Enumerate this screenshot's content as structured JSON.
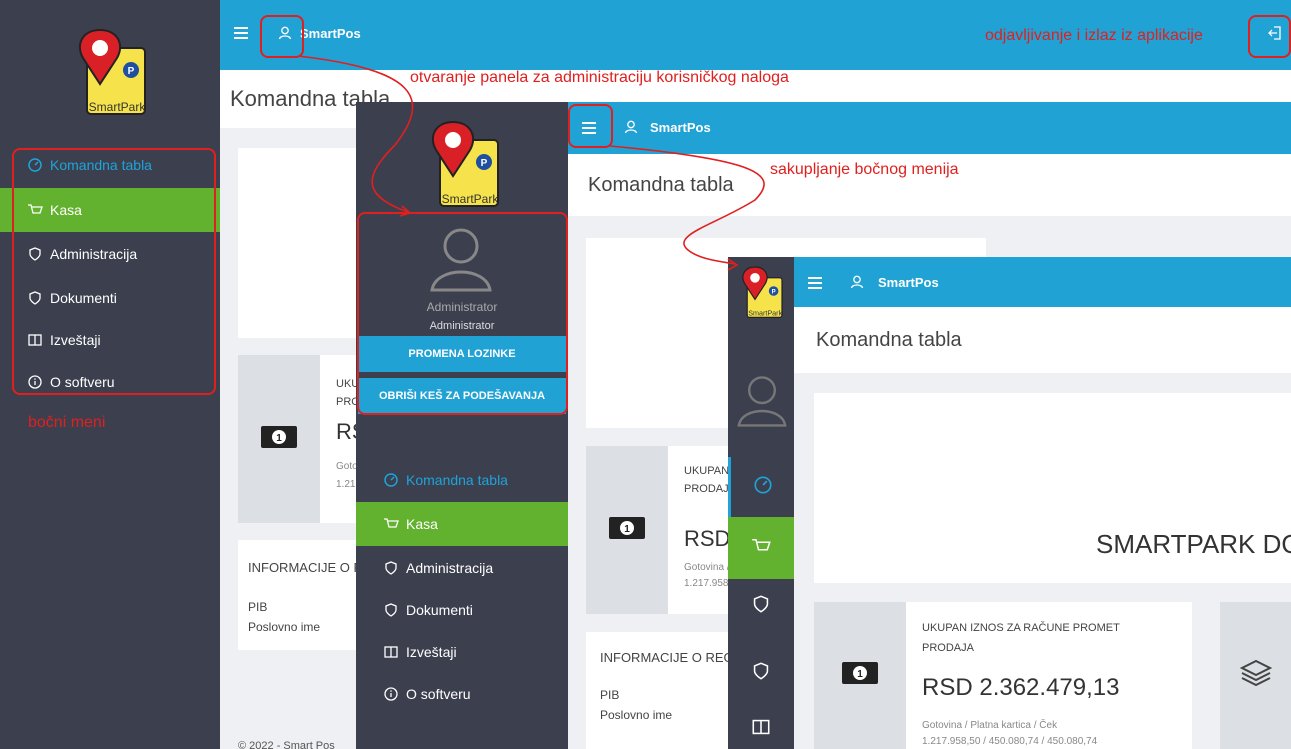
{
  "app": {
    "name": "SmartPos",
    "logo_text": "SmartPark"
  },
  "page": {
    "title": "Komandna tabla"
  },
  "sidebar": {
    "items": [
      {
        "label": "Komandna tabla",
        "icon": "gauge-icon"
      },
      {
        "label": "Kasa",
        "icon": "cart-icon"
      },
      {
        "label": "Administracija",
        "icon": "shield-icon"
      },
      {
        "label": "Dokumenti",
        "icon": "shield-icon"
      },
      {
        "label": "Izveštaji",
        "icon": "book-icon"
      },
      {
        "label": "O softveru",
        "icon": "info-icon"
      }
    ]
  },
  "user_panel": {
    "name": "Administrator",
    "role": "Administrator",
    "change_password": "PROMENA LOZINKE",
    "clear_cache": "OBRIŠI KEŠ ZA PODEŠAVANJA"
  },
  "stats": {
    "total_label_1": "UKUPAN IZNOS ZA RAČUNE PROMET",
    "total_label_2": "PRODAJA",
    "total_value": "RSD 2.362.479,13",
    "payment_methods": "Gotovina / Platna kartica / Ček",
    "payment_values": "1.217.958,50 / 450.080,74 / 450.080,74"
  },
  "info": {
    "title": "INFORMACIJE O REGISTRACIJI",
    "pib_label": "PIB",
    "business_name_label": "Poslovno ime"
  },
  "banner": {
    "text": "SMARTPARK DOO"
  },
  "footer": {
    "copyright": "© 2022 - Smart Pos"
  },
  "annotations": {
    "logout": "odjavljivanje i izlaz iz aplikacije",
    "open_admin": "otvaranje panela za administraciju korisničkog naloga",
    "collapse_menu": "sakupljanje bočnog menija",
    "side_menu": "bočni meni"
  },
  "colors": {
    "topbar": "#21a2d5",
    "sidebar": "#3c3f4e",
    "active_green": "#63b22f",
    "annotation_red": "#e0201f"
  }
}
